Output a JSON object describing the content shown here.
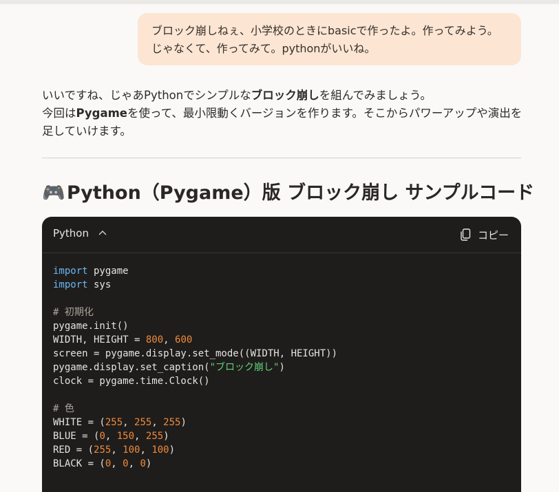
{
  "user_message": "ブロック崩しねぇ、小学校のときにbasicで作ったよ。作ってみよう。じゃなくて、作ってみて。pythonがいいね。",
  "assistant": {
    "l1_pre": "いいですね、じゃあPythonでシンプルな",
    "l1_bold": "ブロック崩し",
    "l1_post": "を組んでみましょう。",
    "l2_pre": "今回は",
    "l2_bold": "Pygame",
    "l2_post": "を使って、最小限動くバージョンを作ります。そこからパワーアップや演出を足していけます。"
  },
  "heading": {
    "emoji": "🎮",
    "text": "Python（Pygame）版 ブロック崩し サンプルコード"
  },
  "code_block": {
    "language": "Python",
    "copy_label": "コピー",
    "collapse_icon": "chevron-up-icon",
    "copy_icon": "copy-icon",
    "lines": {
      "l1_kw": "import",
      "l1_rest": " pygame",
      "l2_kw": "import",
      "l2_rest": " sys",
      "l4": "# 初期化",
      "l5": "pygame.init()",
      "l6_a": "WIDTH, HEIGHT = ",
      "l6_n1": "800",
      "l6_b": ", ",
      "l6_n2": "600",
      "l7": "screen = pygame.display.set_mode((WIDTH, HEIGHT))",
      "l8_a": "pygame.display.set_caption(",
      "l8_s": "\"ブロック崩し\"",
      "l8_b": ")",
      "l9": "clock = pygame.time.Clock()",
      "l11": "# 色",
      "l12_a": "WHITE = (",
      "l12_n1": "255",
      "l12_n2": "255",
      "l12_n3": "255",
      "l13_a": "BLUE = (",
      "l13_n1": "0",
      "l13_n2": "150",
      "l13_n3": "255",
      "l14_a": "RED = (",
      "l14_n1": "255",
      "l14_n2": "100",
      "l14_n3": "100",
      "l15_a": "BLACK = (",
      "l15_n1": "0",
      "l15_n2": "0",
      "l15_n3": "0",
      "sep": ", ",
      "close": ")"
    }
  },
  "colors": {
    "user_bubble": "#fce5d2",
    "code_bg": "#1f1d1b",
    "keyword": "#6cb6f0",
    "number": "#f08a3c",
    "string": "#5fcf7a",
    "comment": "#a9a39c"
  }
}
